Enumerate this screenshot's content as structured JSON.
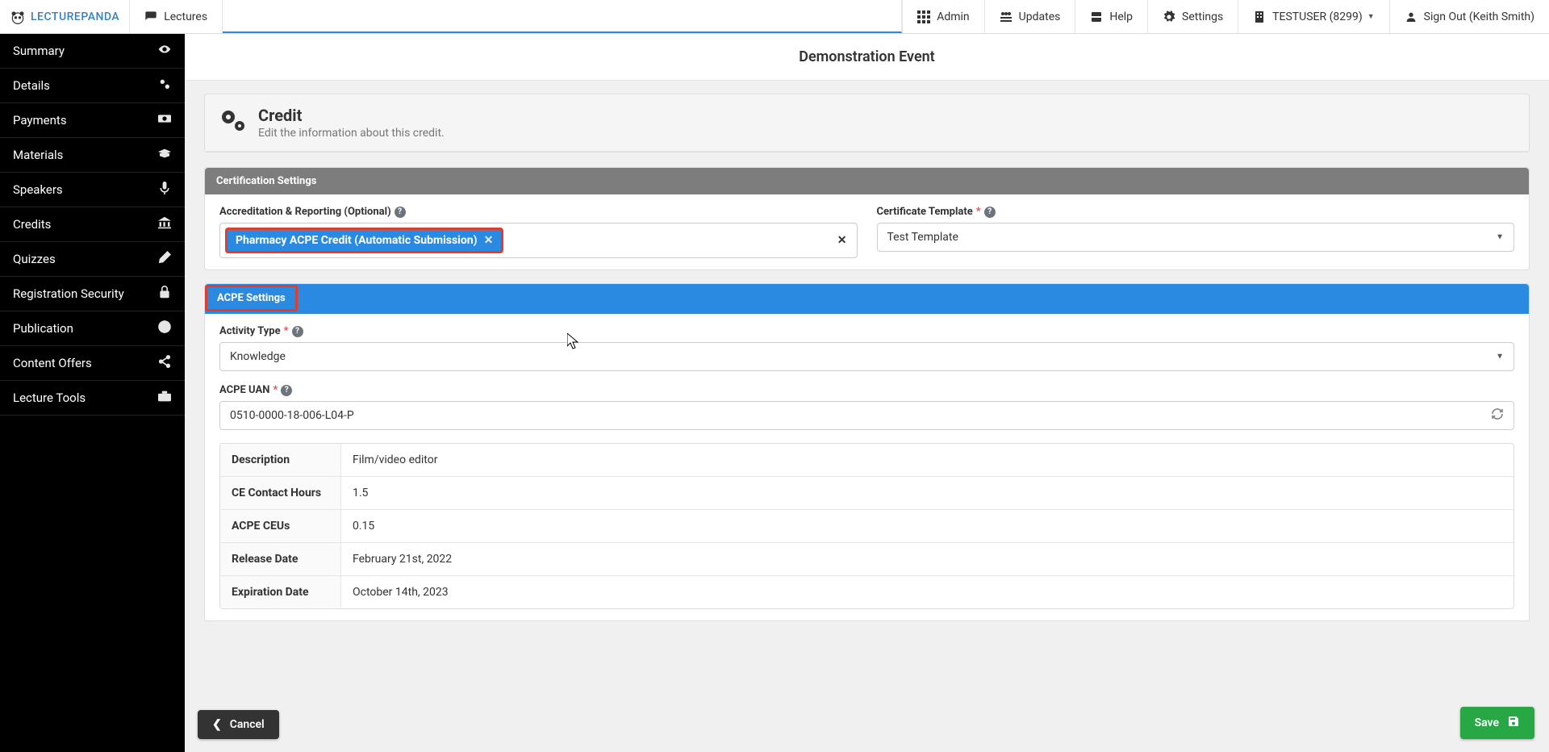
{
  "brand": "LECTUREPANDA",
  "topnav": {
    "lectures": "Lectures",
    "admin": "Admin",
    "updates": "Updates",
    "help": "Help",
    "settings": "Settings",
    "tenant": "TESTUSER (8299)",
    "signout": "Sign Out (Keith Smith)"
  },
  "sidebar": [
    {
      "label": "Summary",
      "icon": "eye"
    },
    {
      "label": "Details",
      "icon": "gears"
    },
    {
      "label": "Payments",
      "icon": "money"
    },
    {
      "label": "Materials",
      "icon": "grad"
    },
    {
      "label": "Speakers",
      "icon": "mic"
    },
    {
      "label": "Credits",
      "icon": "bank"
    },
    {
      "label": "Quizzes",
      "icon": "pencil"
    },
    {
      "label": "Registration Security",
      "icon": "lock"
    },
    {
      "label": "Publication",
      "icon": "globe"
    },
    {
      "label": "Content Offers",
      "icon": "share"
    },
    {
      "label": "Lecture Tools",
      "icon": "briefcase"
    }
  ],
  "page_title": "Demonstration Event",
  "credit_panel": {
    "title": "Credit",
    "subtitle": "Edit the information about this credit."
  },
  "cert_section": {
    "title": "Certification Settings",
    "accred_label": "Accreditation & Reporting (Optional)",
    "accred_token": "Pharmacy ACPE Credit (Automatic Submission)",
    "template_label": "Certificate Template",
    "template_value": "Test Template"
  },
  "acpe_section": {
    "title": "ACPE Settings",
    "activity_type_label": "Activity Type",
    "activity_type_value": "Knowledge",
    "uan_label": "ACPE UAN",
    "uan_value": "0510-0000-18-006-L04-P",
    "rows": [
      {
        "k": "Description",
        "v": "Film/video editor"
      },
      {
        "k": "CE Contact Hours",
        "v": "1.5"
      },
      {
        "k": "ACPE CEUs",
        "v": "0.15"
      },
      {
        "k": "Release Date",
        "v": "February 21st, 2022"
      },
      {
        "k": "Expiration Date",
        "v": "October 14th, 2023"
      }
    ]
  },
  "buttons": {
    "cancel": "Cancel",
    "save": "Save"
  }
}
